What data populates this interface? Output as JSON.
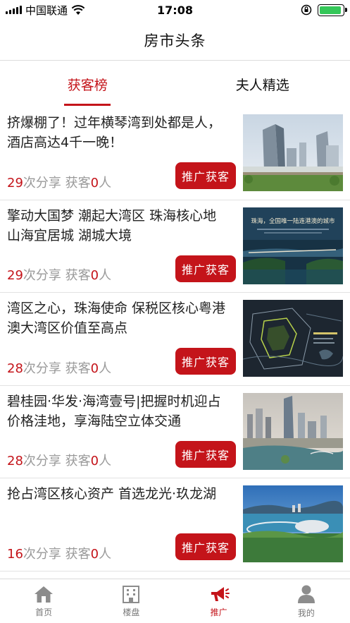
{
  "status_bar": {
    "carrier": "中国联通",
    "time": "17:08",
    "battery_percent": 95,
    "battery_color": "#35c759"
  },
  "nav": {
    "title": "房市头条"
  },
  "tabs": [
    {
      "label": "获客榜",
      "active": true
    },
    {
      "label": "夫人精选",
      "active": false
    }
  ],
  "accent_color": "#c4141a",
  "promo_label": "推广获客",
  "stat_labels": {
    "share_suffix": "次分享",
    "customer_prefix": "获客",
    "customer_suffix": "人"
  },
  "articles": [
    {
      "title": "挤爆棚了！过年横琴湾到处都是人，酒店高达4千一晚！",
      "shares": "29",
      "customers": "0"
    },
    {
      "title": "擎动大国梦 潮起大湾区 珠海核心地  山海宜居城 湖城大境",
      "shares": "29",
      "customers": "0",
      "image_text": "珠海，全国唯一陆连港澳的城市"
    },
    {
      "title": "湾区之心，珠海使命 保税区核心粤港澳大湾区价值至高点",
      "shares": "28",
      "customers": "0"
    },
    {
      "title": "碧桂园·华发·海湾壹号|把握时机迎占价格洼地，享海陆空立体交通",
      "shares": "28",
      "customers": "0"
    },
    {
      "title": "抢占湾区核心资产 首选龙光·玖龙湖",
      "shares": "16",
      "customers": "0"
    }
  ],
  "bottom_tabs": [
    {
      "label": "首页",
      "icon": "home-icon",
      "active": false
    },
    {
      "label": "楼盘",
      "icon": "building-icon",
      "active": false
    },
    {
      "label": "推广",
      "icon": "megaphone-icon",
      "active": true
    },
    {
      "label": "我的",
      "icon": "person-icon",
      "active": false
    }
  ]
}
